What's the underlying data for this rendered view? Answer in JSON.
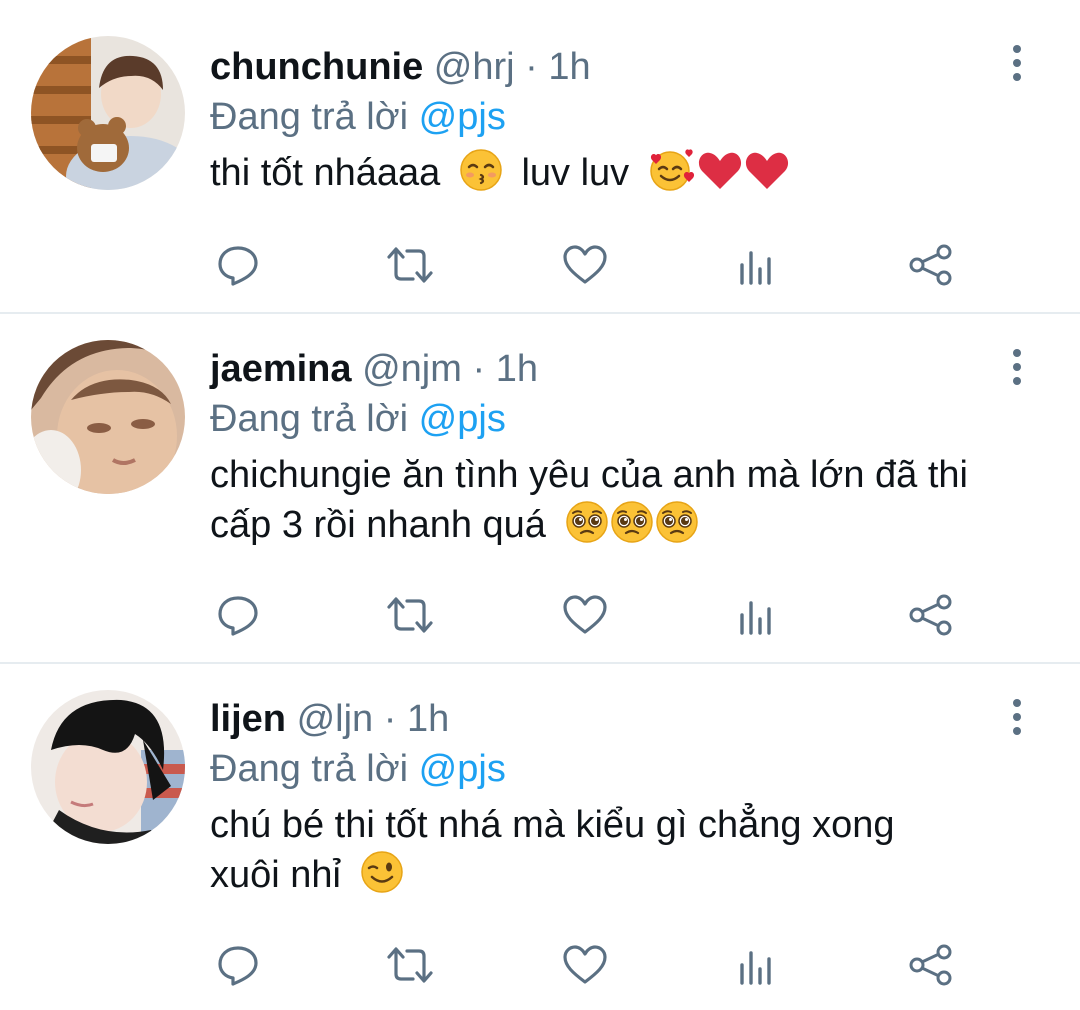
{
  "colors": {
    "primary_text": "#0f1419",
    "secondary_text": "#5b7083",
    "mention": "#1da1f2",
    "divider": "#e6ecf0"
  },
  "tweets": [
    {
      "display_name": "chunchunie",
      "handle": "@hrj",
      "separator": "·",
      "time": "1h",
      "reply_prefix": "Đang trả lời",
      "reply_to": "@pjs",
      "lines": [
        "thi tốt nháaaa",
        "luv luv"
      ],
      "emojis_inline": [
        "kissing-face-closed-eyes-emoji"
      ],
      "emojis_trailing": [
        "smiling-face-with-hearts-emoji",
        "red-heart-emoji",
        "red-heart-emoji"
      ]
    },
    {
      "display_name": "jaemina",
      "handle": "@njm",
      "separator": "·",
      "time": "1h",
      "reply_prefix": "Đang trả lời",
      "reply_to": "@pjs",
      "lines": [
        "chichungie ăn tình yêu của anh mà lớn đã thi",
        "cấp 3 rồi nhanh quá"
      ],
      "emojis_trailing": [
        "pleading-face-emoji",
        "pleading-face-emoji",
        "pleading-face-emoji"
      ]
    },
    {
      "display_name": "lijen",
      "handle": "@ljn",
      "separator": "·",
      "time": "1h",
      "reply_prefix": "Đang trả lời",
      "reply_to": "@pjs",
      "lines": [
        "chú bé thi tốt nhá mà kiểu gì chẳng xong",
        "xuôi nhỉ"
      ],
      "emojis_trailing": [
        "winking-face-emoji"
      ]
    }
  ],
  "actions": [
    "reply-icon",
    "retweet-icon",
    "like-icon",
    "analytics-icon",
    "share-icon"
  ]
}
